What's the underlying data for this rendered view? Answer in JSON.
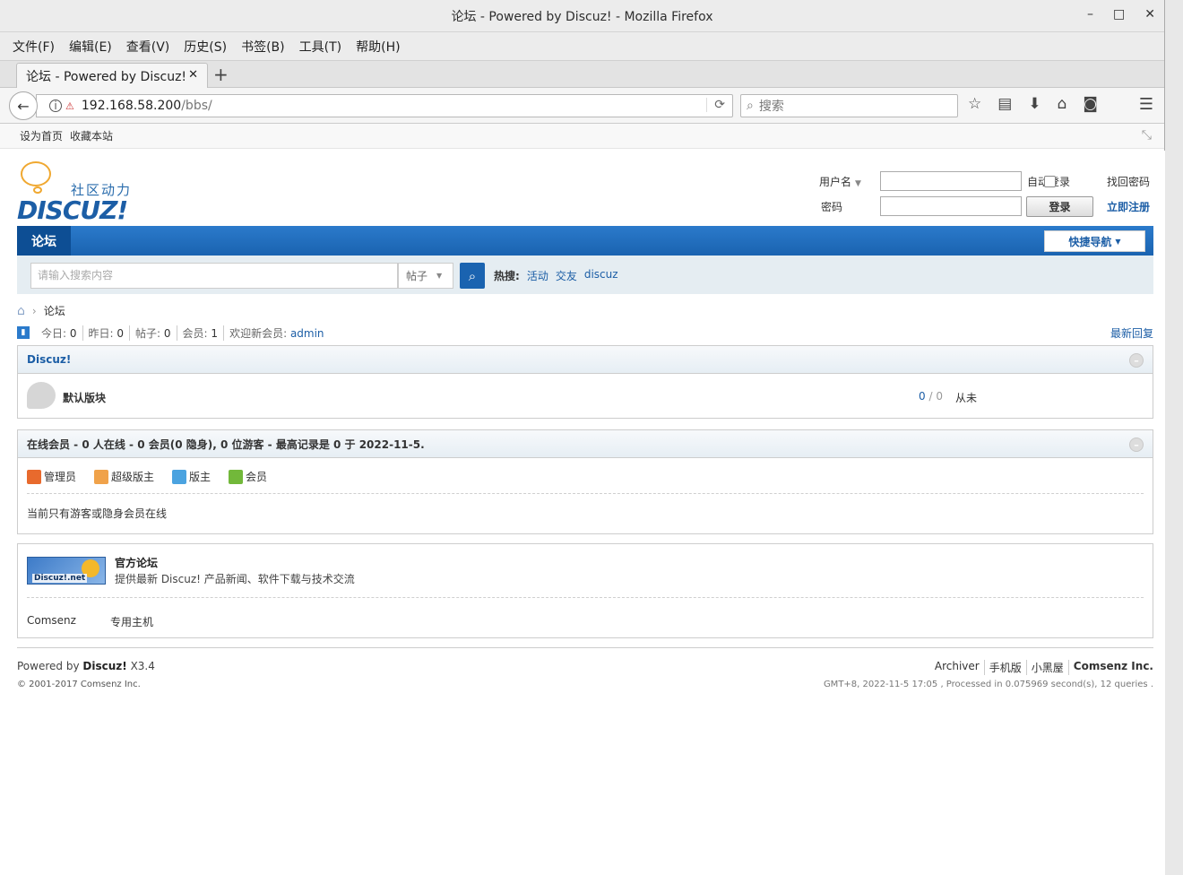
{
  "window": {
    "title": "论坛 - Powered by Discuz! - Mozilla Firefox",
    "controls": {
      "minimize": "–",
      "maximize": "□",
      "close": "✕"
    }
  },
  "menubar": {
    "items": [
      "文件(F)",
      "编辑(E)",
      "查看(V)",
      "历史(S)",
      "书签(B)",
      "工具(T)",
      "帮助(H)"
    ]
  },
  "tab": {
    "label": "论坛 - Powered by Discuz!",
    "close": "✕",
    "new": "+"
  },
  "urlbar": {
    "host": "192.168.58.200",
    "path": "/bbs/"
  },
  "searchbar": {
    "placeholder": "搜索"
  },
  "bookmarks": {
    "items": [
      "设为首页",
      "收藏本站"
    ]
  },
  "site": {
    "logo_tagline": "社区动力",
    "logo_brand": "DISCUZ!",
    "login": {
      "username_label": "用户名",
      "password_label": "密码",
      "autologin_label": "自动登录",
      "login_button": "登录",
      "forgot_label": "找回密码",
      "register_label": "立即注册"
    },
    "nav": {
      "forum_tab": "论坛",
      "quicknav": "快捷导航"
    },
    "search": {
      "placeholder": "请输入搜索内容",
      "type": "帖子",
      "hot_label": "热搜:",
      "hot_keywords": [
        "活动",
        "交友",
        "discuz"
      ]
    },
    "breadcrumb": {
      "current": "论坛"
    },
    "stats": {
      "today_label": "今日:",
      "today": "0",
      "yesterday_label": "昨日:",
      "yesterday": "0",
      "posts_label": "帖子:",
      "posts": "0",
      "members_label": "会员:",
      "members": "1",
      "welcome_label": "欢迎新会员:",
      "newest_member": "admin",
      "latest_replies": "最新回复"
    },
    "category": {
      "title": "Discuz!",
      "forums": [
        {
          "name": "默认版块",
          "threads": "0",
          "posts": "0",
          "last_post": "从未"
        }
      ]
    },
    "online": {
      "header": "在线会员 - 0 人在线 - 0 会员(0 隐身), 0 位游客 - 最高记录是 0 于 2022-11-5.",
      "legend": [
        "管理员",
        "超级版主",
        "版主",
        "会员"
      ],
      "note": "当前只有游客或隐身会员在线"
    },
    "links": {
      "featured_name": "官方论坛",
      "featured_desc": "提供最新 Discuz! 产品新闻、软件下载与技术交流",
      "featured_logo_text": "Discuz!.net",
      "text_links": [
        "Comsenz",
        "专用主机"
      ]
    },
    "footer": {
      "powered_prefix": "Powered by",
      "powered_brand": "Discuz!",
      "version": "X3.4",
      "copyright": "© 2001-2017 Comsenz Inc.",
      "links": [
        "Archiver",
        "手机版",
        "小黑屋",
        "Comsenz Inc."
      ],
      "stats_line": "GMT+8, 2022-11-5 17:05 , Processed in 0.075969 second(s), 12 queries ."
    }
  },
  "colors": {
    "accent": "#1c5ea6",
    "nav_bg": "#2b7acb"
  }
}
